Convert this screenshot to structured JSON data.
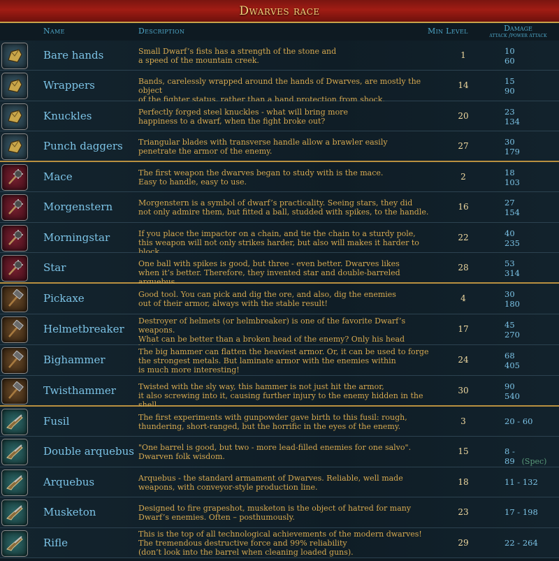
{
  "title": "Dwarves race",
  "headers": {
    "name": "Name",
    "description": "Description",
    "min_level": "Min Level",
    "damage": "Damage",
    "damage_sub": "attack /power attack"
  },
  "rows": [
    {
      "icon": "fist-weapon-icon",
      "name": "Bare hands",
      "desc": "Small Dwarf’s fists has a strength of the stone and\na speed of the mountain creek.",
      "level": "1",
      "attack": "10",
      "power": "60"
    },
    {
      "icon": "fist-weapon-icon",
      "name": "Wrappers",
      "desc": "Bands, carelessly wrapped around the hands of Dwarves, are mostly the object\nof the fighter status, rather than a hand protection from shock.",
      "level": "14",
      "attack": "15",
      "power": "90"
    },
    {
      "icon": "fist-weapon-icon",
      "name": "Knuckles",
      "desc": "Perfectly forged steel knuckles - what will bring more\nhappiness to a dwarf, when the fight broke out?",
      "level": "20",
      "attack": "23",
      "power": "134"
    },
    {
      "icon": "fist-weapon-icon",
      "name": "Punch daggers",
      "desc": "Triangular blades with transverse handle allow a brawler easily\npenetrate the armor of the enemy.",
      "level": "27",
      "attack": "30",
      "power": "179"
    },
    {
      "icon": "mace-weapon-icon",
      "name": "Mace",
      "desc": "The first weapon the dwarves began to study with is the mace.\nEasy to handle, easy to use.",
      "level": "2",
      "attack": "18",
      "power": "103"
    },
    {
      "icon": "mace-weapon-icon",
      "name": "Morgenstern",
      "desc": "Morgenstern is a symbol of dwarf’s practicality. Seeing stars, they did\nnot only admire them, but fitted a ball, studded with spikes, to the handle.",
      "level": "16",
      "attack": "27",
      "power": "154"
    },
    {
      "icon": "mace-weapon-icon",
      "name": "Morningstar",
      "desc": "If you place the impactor on a chain, and tie the chain to a sturdy pole,\nthis weapon will not only strikes harder, but also will makes it harder to block.",
      "level": "22",
      "attack": "40",
      "power": "235"
    },
    {
      "icon": "mace-weapon-icon",
      "name": "Star",
      "desc": "One ball with spikes is good, but three - even better. Dwarves likes\nwhen it’s better. Therefore, they invented star and double-barreled arquebus.",
      "level": "28",
      "attack": "53",
      "power": "314"
    },
    {
      "icon": "hammer-weapon-icon",
      "name": "Pickaxe",
      "desc": "Good tool. You can pick and dig the ore, and also, dig the enemies\nout of their armor, always with the stable result!",
      "level": "4",
      "attack": "30",
      "power": "180"
    },
    {
      "icon": "hammer-weapon-icon",
      "name": "Helmetbreaker",
      "desc": "Destroyer of helmets (or helmbreaker) is one of the favorite Dwarf’s weapons.\nWhat can be better than a broken head of the enemy? Only his head broken\nwith the helmetbreaker!",
      "level": "17",
      "attack": "45",
      "power": "270"
    },
    {
      "icon": "hammer-weapon-icon",
      "name": "Bighammer",
      "desc": "The big hammer can flatten the heaviest armor. Or, it can be used to forge\nthe strongest metals. But laminate armor with the enemies within\nis much more interesting!",
      "level": "24",
      "attack": "68",
      "power": "405"
    },
    {
      "icon": "hammer-weapon-icon",
      "name": "Twisthammer",
      "desc": "Twisted with the sly way, this hammer is not just hit the armor,\nit also screwing into it, causing further injury to the enemy hidden in the shell.",
      "level": "30",
      "attack": "90",
      "power": "540"
    },
    {
      "icon": "gun-weapon-icon",
      "name": "Fusil",
      "desc": "The first experiments with gunpowder gave birth to this fusil: rough,\nthundering, short-ranged, but the horrific in the eyes of the enemy.",
      "level": "3",
      "attack": "20 - 60",
      "power": ""
    },
    {
      "icon": "gun-weapon-icon",
      "name": "Double arquebus",
      "desc": "\"One barrel is good, but two - more lead-filled enemies for one salvo\".\nDwarven folk wisdom.",
      "level": "15",
      "attack": "8 - 89",
      "power": "",
      "spec": "(Spec)"
    },
    {
      "icon": "gun-weapon-icon",
      "name": "Arquebus",
      "desc": "Arquebus - the standard armament of Dwarves. Reliable, well made\nweapons, with conveyor-style production line.",
      "level": "18",
      "attack": "11 - 132",
      "power": ""
    },
    {
      "icon": "gun-weapon-icon",
      "name": "Musketon",
      "desc": "Designed to fire grapeshot, musketon is the object of hatred for many\nDwarf’s enemies. Often – posthumously.",
      "level": "23",
      "attack": "17 - 198",
      "power": ""
    },
    {
      "icon": "gun-weapon-icon",
      "name": "Rifle",
      "desc": "This is the top of all technological achievements of the modern dwarves!\nThe tremendous destructive force and 99% reliability\n(don’t look into the barrel when cleaning loaded guns).",
      "level": "29",
      "attack": "22 - 264",
      "power": ""
    }
  ]
}
